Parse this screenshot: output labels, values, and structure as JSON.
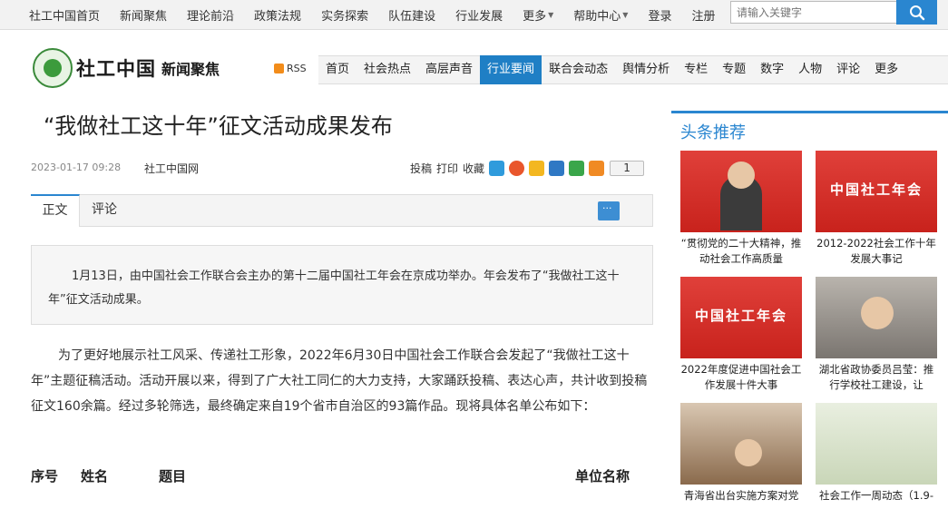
{
  "topnav": {
    "items": [
      "社工中国首页",
      "新闻聚焦",
      "理论前沿",
      "政策法规",
      "实务探索",
      "队伍建设",
      "行业发展"
    ],
    "more": "更多",
    "help": "帮助中心",
    "login": "登录",
    "register": "注册"
  },
  "search": {
    "placeholder": "请输入关键字"
  },
  "logo": {
    "name": "社工中国",
    "section": "新闻聚焦"
  },
  "rss": "RSS",
  "mainnav": [
    "首页",
    "社会热点",
    "高层声音",
    "行业要闻",
    "联合会动态",
    "舆情分析",
    "专栏",
    "专题",
    "数字",
    "人物",
    "评论",
    "更多"
  ],
  "article": {
    "title": "“我做社工这十年”征文活动成果发布",
    "date": "2023-01-17 09:28",
    "source": "社工中国网",
    "actions": [
      "投稿",
      "打印",
      "收藏"
    ],
    "like_count": "1",
    "tab_main": "正文",
    "tab_comment": "评论",
    "summary": "1月13日，由中国社会工作联合会主办的第十二届中国社工年会在京成功举办。年会发布了“我做社工这十年”征文活动成果。",
    "body": "为了更好地展示社工风采、传递社工形象，2022年6月30日中国社会工作联合会发起了“我做社工这十年”主题征稿活动。活动开展以来，得到了广大社工同仁的大力支持，大家踊跃投稿、表达心声，共计收到投稿征文160余篇。经过多轮筛选，最终确定来自19个省市自治区的93篇作品。现将具体名单公布如下：",
    "table_headers": [
      "序号",
      "姓名",
      "题目",
      "单位名称"
    ]
  },
  "sidebar": {
    "title": "头条推荐",
    "cards": [
      {
        "caption": "“贯彻党的二十大精神，推动社会工作高质量"
      },
      {
        "caption": "2012-2022社会工作十年发展大事记"
      },
      {
        "caption": "2022年度促进中国社会工作发展十件大事"
      },
      {
        "caption": "湖北省政协委员吕莹：推行学校社工建设，让"
      },
      {
        "caption": "青海省出台实施方案对党"
      },
      {
        "caption": "社会工作一周动态（1.9-"
      }
    ],
    "banner_text": "中国社工年会"
  },
  "colors": {
    "accent": "#2a86d0",
    "nav_active": "#1f7fc5",
    "headline_red": "#d9302a"
  }
}
